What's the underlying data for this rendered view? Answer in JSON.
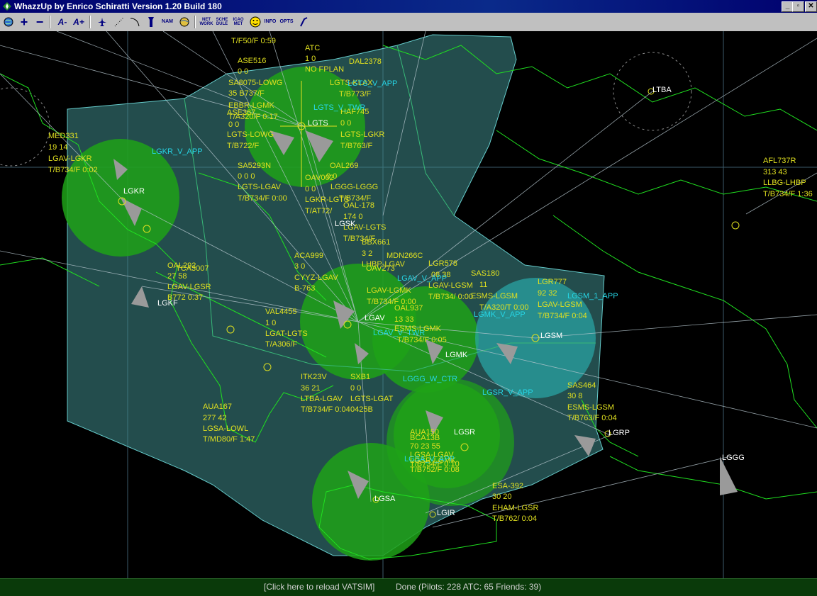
{
  "window": {
    "title": "WhazzUp by Enrico Schiratti Version 1.20 Build 180",
    "minimize": "_",
    "maximize": "▫",
    "close": "✕"
  },
  "toolbar": {
    "zoom_in": "+",
    "zoom_out": "−",
    "font_smaller": "A-",
    "font_larger": "A+",
    "network": "NET\nWORK",
    "schedule": "SCHE\nDULE",
    "icao_met": "ICAO\nMET",
    "nam": "NAM",
    "info": "INFO",
    "opts": "OPTS"
  },
  "labels": {
    "l1": "T/F50/F 0:59",
    "l2": "ATC",
    "l3": "1 0",
    "l4": "NO FPLAN",
    "l5": "ASE516",
    "l6": "0 0",
    "l7": "DAL2378",
    "l8": "SA8075-LOWG",
    "l9": "LGTS-KLAX",
    "l10": "35 B737/F",
    "l11": "T/B773/F",
    "l12": "EBBR-LGMK",
    "l13": "ASE367",
    "l14": "T/A320/F 0:17",
    "l15": "0 0",
    "l16": "HAF745",
    "l17": "0 0",
    "l18": "LGTS-LOWG",
    "l19": "LGTS-LGKR",
    "l20": "T/B722/F",
    "l21": "T/B763/F",
    "l22": "MED331",
    "l23": "19 14",
    "l24": "LGAV-LGKR",
    "l25": "T/B734/F 0:02",
    "l26": "SA5293N",
    "l27": "OAL269",
    "l28": "0 0 0",
    "l29": "OAV002",
    "l30": "0 0",
    "l31": "LGTS-LGAV",
    "l32": "0 0",
    "l33": "LGGG-LGGG",
    "l34": "T/B734/F 0:00",
    "l35": "LGKR-LGTS",
    "l36": "T/B734/F",
    "l37": "T/AT72/",
    "l38": "OAL-178",
    "l39": "174 0",
    "l40": "LGAV-LGTS",
    "l41": "T/B734/F",
    "l42": "BBX661",
    "l43": "3 2",
    "l44": "ACA999",
    "l45": "MDN266C",
    "l46": "3 0",
    "l47": "LHBP-LGAV",
    "l48": "LGR578",
    "l49": "OAL292",
    "l50": "TCA3007",
    "l51": "OAV273",
    "l52": "08 38",
    "l53": "SAS180",
    "l54": "LGR777",
    "l55": "27 58",
    "l56": "LGAV-LGSR",
    "l57": "CYYZ-LGAV",
    "l58": "11",
    "l59": "92 32",
    "l60": "B772 0:37",
    "l61": "B-763",
    "l62": "LGAV-LGMK",
    "l63": "LGAV-LGSM",
    "l64": "T/B734/F 0:00",
    "l65": "ESMS-LGSM",
    "l66": "T/B734/ 0:00",
    "l67": "T/A320/T 0:00",
    "l68": "T/B734/F 0:04",
    "l69": "VAL4455",
    "l70": "1 0",
    "l71": "OAL937",
    "l72": "13 33",
    "l73": "ESMS-LGMK",
    "l74": "LGAT-LGTS",
    "l75": "T/A306/F",
    "l76": "T/B734/F 0:05",
    "l77": "AFL737R",
    "l78": "313 43",
    "l79": "LLBG-LHBP",
    "l80": "T/B734/F 1:36",
    "l81": "ITK23V",
    "l82": "SXB1",
    "l83": "36 21",
    "l84": "0 0",
    "l85": "LTBA-LGAV",
    "l86": "LGTS-LGAT",
    "l87": "T/B734/F 0:04",
    "l88": "0425B",
    "l89": "SAS464",
    "l90": "30 8",
    "l91": "ESMS-LGSM",
    "l92": "T/B763/F 0:04",
    "l93": "AUA167",
    "l94": "277 42",
    "l95": "LGSA-LOWL",
    "l96": "T/MD80/F 1:47",
    "l97": "AUA150",
    "l98": "BCA13B",
    "l99": "70 23 55",
    "l100": "LGSA-LGAV",
    "l101": "LGSR-LGMK",
    "l102": "T/B752/F 0:08",
    "l103": "T/B734/F 0:10",
    "l104": "ESA-392",
    "l105": "30 20",
    "l106": "EHAM-LGSR",
    "l107": "T/B762/ 0:04"
  },
  "airports": {
    "lgts": "LGTS",
    "lgkr": "LGKR",
    "lgsk": "LGSK",
    "lgkf": "LGKF",
    "lgav": "LGAV",
    "lgmk": "LGMK",
    "lgsm": "LGSM",
    "lgsr": "LGSR",
    "lgrp": "LGRP",
    "lgsa": "LGSA",
    "lgir": "LGIR",
    "lggg": "LGGG",
    "ltba": "LTBA"
  },
  "controllers": {
    "lgts_app": "LGTS_V_APP",
    "lgts_twr": "LGTS_V_TWR",
    "lgkr_app": "LGKR_V_APP",
    "lgav_app": "LGAV_V_APP",
    "lgav_twr": "LGAV_V_TWR",
    "lgsm_app": "LGSM_1_APP",
    "lgmk_app": "LGMK_V_APP",
    "lggg_ctr": "LGGG_W_CTR",
    "lgsr_app": "LGSR_V_APP",
    "lgsa_app": "LGSA_V_APP"
  },
  "status": {
    "reload": "[Click here to reload VATSIM]",
    "summary": "Done (Pilots: 228  ATC: 65  Friends: 39)"
  },
  "colors": {
    "fir": "#4aa0a0",
    "coverage": "#22a21a",
    "coast": "#20e020",
    "pilot_label": "#e0e020",
    "airport_label": "#ffffff",
    "controller_label": "#27d6e6"
  }
}
